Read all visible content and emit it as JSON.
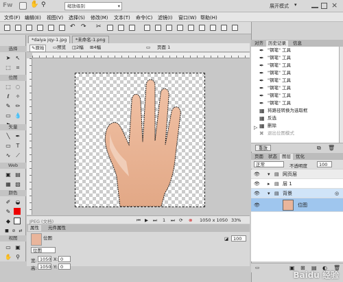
{
  "app": {
    "logo": "Fw",
    "zoom_select": "缩放级别",
    "workspace": "展开模式"
  },
  "menu": [
    "文件(F)",
    "编辑(E)",
    "视图(V)",
    "选择(S)",
    "修改(M)",
    "文本(T)",
    "命令(C)",
    "滤镜(I)",
    "窗口(W)",
    "帮助(H)"
  ],
  "tools": {
    "sections": [
      "选择",
      "位图",
      "矢量",
      "Web",
      "颜色",
      "视图"
    ]
  },
  "doc_tabs": [
    "*daiya jqy-1.jpg",
    "*未命名-1.png"
  ],
  "view_bar": {
    "original": "原始",
    "preview": "预览",
    "two_up": "2幅",
    "four_up": "4幅",
    "page": "页面 1"
  },
  "status": {
    "mode": "JPEG (文档)",
    "page_num": "1",
    "size": "1050 x 1050",
    "zoom": "33%"
  },
  "props": {
    "tabs": [
      "属性",
      "元件属性"
    ],
    "type": "位图",
    "name": "位图",
    "w_label": "宽:",
    "w_value": "1050",
    "h_label": "高:",
    "h_value": "1050",
    "x_label": "X:",
    "x_value": "0",
    "y_label": "Y:",
    "y_value": "0",
    "opacity": "100"
  },
  "right_panel": {
    "top_tabs": [
      "对齐",
      "历史记录",
      "信息"
    ],
    "history": [
      "\"钢笔\" 工具",
      "\"钢笔\" 工具",
      "\"钢笔\" 工具",
      "\"钢笔\" 工具",
      "\"钢笔\" 工具",
      "\"钢笔\" 工具",
      "\"钢笔\" 工具",
      "\"钢笔\" 工具",
      "将路径转换为选取框",
      "反选",
      "删除",
      "退出位图模式"
    ],
    "replay_label": "重放",
    "layer_tabs": [
      "页面",
      "状态",
      "图层",
      "优化"
    ],
    "blend": "正常",
    "opacity_label": "不透明度",
    "opacity_value": "100",
    "layers": [
      {
        "name": "网页层"
      },
      {
        "name": "层 1"
      },
      {
        "name": "背景"
      },
      {
        "name": "位图"
      }
    ]
  },
  "watermark": "Baidu 经验"
}
